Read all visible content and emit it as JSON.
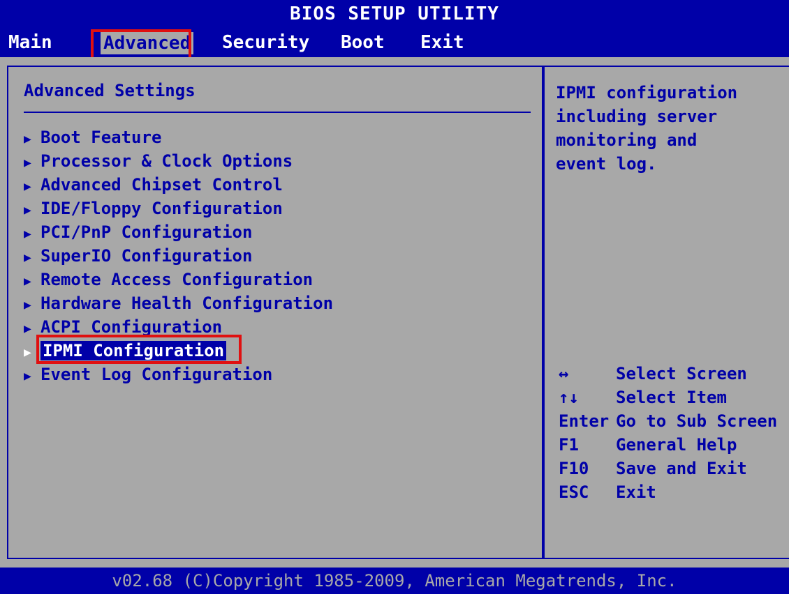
{
  "title": "BIOS SETUP UTILITY",
  "menu": {
    "main": "Main",
    "advanced": "Advanced",
    "security": "Security",
    "boot": "Boot",
    "exit": "Exit"
  },
  "section_title": "Advanced Settings",
  "items": [
    "Boot Feature",
    "Processor & Clock Options",
    "Advanced Chipset Control",
    "IDE/Floppy Configuration",
    "PCI/PnP Configuration",
    "SuperIO Configuration",
    "Remote Access Configuration",
    "Hardware Health Configuration",
    "ACPI Configuration",
    "IPMI Configuration",
    "Event Log Configuration"
  ],
  "selected_item": "IPMI Configuration",
  "help": "IPMI configuration\nincluding server\nmonitoring and\nevent log.",
  "keys": [
    {
      "key": "↔",
      "desc": "Select Screen"
    },
    {
      "key": "↑↓",
      "desc": "Select Item"
    },
    {
      "key": "Enter",
      "desc": "Go to Sub Screen"
    },
    {
      "key": "F1",
      "desc": "General Help"
    },
    {
      "key": "F10",
      "desc": "Save and Exit"
    },
    {
      "key": "ESC",
      "desc": "Exit"
    }
  ],
  "footer": "v02.68 (C)Copyright 1985-2009, American Megatrends, Inc.",
  "colors": {
    "background_blue": "#0000a8",
    "panel_gray": "#a8a8a8",
    "highlight_red": "#e01010"
  }
}
